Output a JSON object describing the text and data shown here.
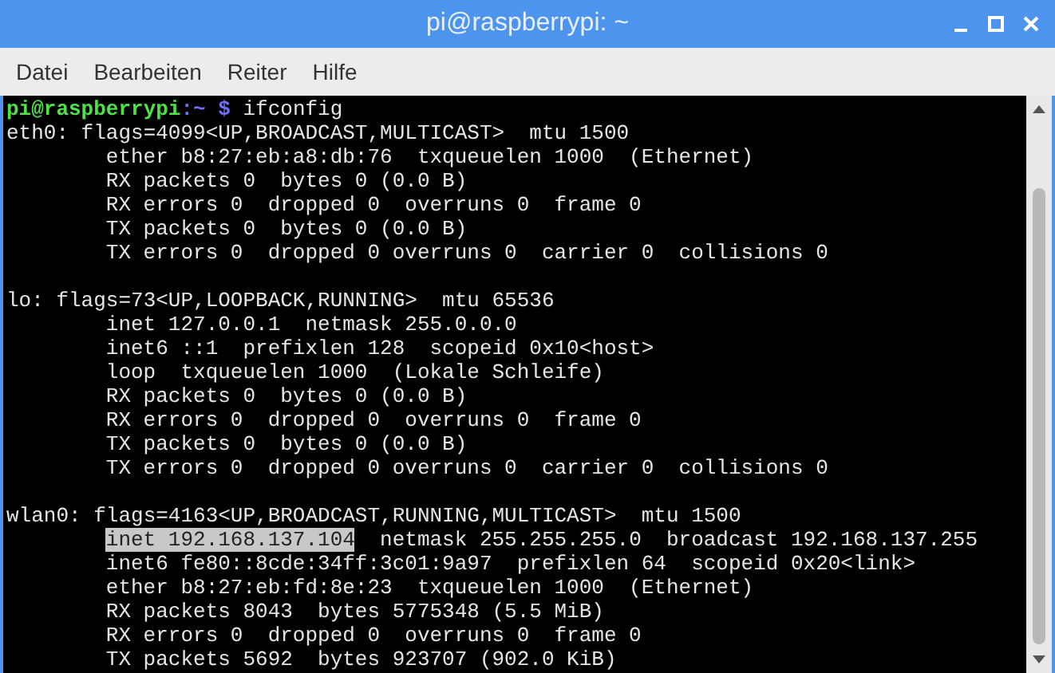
{
  "window": {
    "title": "pi@raspberrypi: ~"
  },
  "menu": [
    "Datei",
    "Bearbeiten",
    "Reiter",
    "Hilfe"
  ],
  "terminal": {
    "lines": [
      {
        "kind": "text",
        "indented": false,
        "spans": [
          {
            "kind": "user",
            "text": "pi@raspberrypi",
            "selected": false
          },
          {
            "kind": "path",
            "text": ":~ $",
            "selected": false
          },
          {
            "kind": "output",
            "text": " ifconfig",
            "selected": false
          }
        ]
      },
      {
        "kind": "text",
        "indented": false,
        "spans": [
          {
            "kind": "output",
            "text": "eth0: flags=4099<UP,BROADCAST,MULTICAST>  mtu 1500",
            "selected": false
          }
        ]
      },
      {
        "kind": "text",
        "indented": true,
        "spans": [
          {
            "kind": "output",
            "text": "ether b8:27:eb:a8:db:76  txqueuelen 1000  (Ethernet)",
            "selected": false
          }
        ]
      },
      {
        "kind": "text",
        "indented": true,
        "spans": [
          {
            "kind": "output",
            "text": "RX packets 0  bytes 0 (0.0 B)",
            "selected": false
          }
        ]
      },
      {
        "kind": "text",
        "indented": true,
        "spans": [
          {
            "kind": "output",
            "text": "RX errors 0  dropped 0  overruns 0  frame 0",
            "selected": false
          }
        ]
      },
      {
        "kind": "text",
        "indented": true,
        "spans": [
          {
            "kind": "output",
            "text": "TX packets 0  bytes 0 (0.0 B)",
            "selected": false
          }
        ]
      },
      {
        "kind": "text",
        "indented": true,
        "spans": [
          {
            "kind": "output",
            "text": "TX errors 0  dropped 0 overruns 0  carrier 0  collisions 0",
            "selected": false
          }
        ]
      },
      {
        "kind": "blank"
      },
      {
        "kind": "text",
        "indented": false,
        "spans": [
          {
            "kind": "output",
            "text": "lo: flags=73<UP,LOOPBACK,RUNNING>  mtu 65536",
            "selected": false
          }
        ]
      },
      {
        "kind": "text",
        "indented": true,
        "spans": [
          {
            "kind": "output",
            "text": "inet 127.0.0.1  netmask 255.0.0.0",
            "selected": false
          }
        ]
      },
      {
        "kind": "text",
        "indented": true,
        "spans": [
          {
            "kind": "output",
            "text": "inet6 ::1  prefixlen 128  scopeid 0x10<host>",
            "selected": false
          }
        ]
      },
      {
        "kind": "text",
        "indented": true,
        "spans": [
          {
            "kind": "output",
            "text": "loop  txqueuelen 1000  (Lokale Schleife)",
            "selected": false
          }
        ]
      },
      {
        "kind": "text",
        "indented": true,
        "spans": [
          {
            "kind": "output",
            "text": "RX packets 0  bytes 0 (0.0 B)",
            "selected": false
          }
        ]
      },
      {
        "kind": "text",
        "indented": true,
        "spans": [
          {
            "kind": "output",
            "text": "RX errors 0  dropped 0  overruns 0  frame 0",
            "selected": false
          }
        ]
      },
      {
        "kind": "text",
        "indented": true,
        "spans": [
          {
            "kind": "output",
            "text": "TX packets 0  bytes 0 (0.0 B)",
            "selected": false
          }
        ]
      },
      {
        "kind": "text",
        "indented": true,
        "spans": [
          {
            "kind": "output",
            "text": "TX errors 0  dropped 0 overruns 0  carrier 0  collisions 0",
            "selected": false
          }
        ]
      },
      {
        "kind": "blank"
      },
      {
        "kind": "text",
        "indented": false,
        "spans": [
          {
            "kind": "output",
            "text": "wlan0: flags=4163<UP,BROADCAST,RUNNING,MULTICAST>  mtu 1500",
            "selected": false
          }
        ]
      },
      {
        "kind": "text",
        "indented": true,
        "spans": [
          {
            "kind": "output",
            "text": "inet 192.168.137.104",
            "selected": true
          },
          {
            "kind": "output",
            "text": "  netmask 255.255.255.0  broadcast 192.168.137.255",
            "selected": false
          }
        ]
      },
      {
        "kind": "text",
        "indented": true,
        "spans": [
          {
            "kind": "output",
            "text": "inet6 fe80::8cde:34ff:3c01:9a97  prefixlen 64  scopeid 0x20<link>",
            "selected": false
          }
        ]
      },
      {
        "kind": "text",
        "indented": true,
        "spans": [
          {
            "kind": "output",
            "text": "ether b8:27:eb:fd:8e:23  txqueuelen 1000  (Ethernet)",
            "selected": false
          }
        ]
      },
      {
        "kind": "text",
        "indented": true,
        "spans": [
          {
            "kind": "output",
            "text": "RX packets 8043  bytes 5775348 (5.5 MiB)",
            "selected": false
          }
        ]
      },
      {
        "kind": "text",
        "indented": true,
        "spans": [
          {
            "kind": "output",
            "text": "RX errors 0  dropped 0  overruns 0  frame 0",
            "selected": false
          }
        ]
      },
      {
        "kind": "text",
        "indented": true,
        "spans": [
          {
            "kind": "output",
            "text": "TX packets 5692  bytes 923707 (902.0 KiB)",
            "selected": false
          }
        ]
      }
    ]
  }
}
